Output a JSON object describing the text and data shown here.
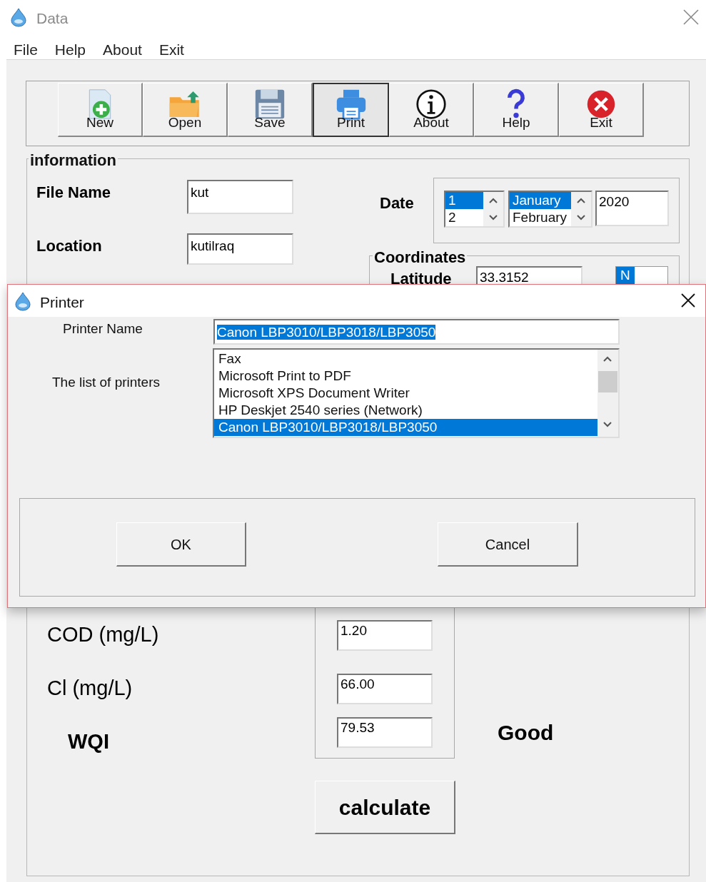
{
  "window": {
    "title": "Data"
  },
  "menu": [
    "File",
    "Help",
    "About",
    "Exit"
  ],
  "toolbar": [
    {
      "label": "New",
      "kind": "new",
      "selected": false
    },
    {
      "label": "Open",
      "kind": "open",
      "selected": false
    },
    {
      "label": "Save",
      "kind": "save",
      "selected": false
    },
    {
      "label": "Print",
      "kind": "print",
      "selected": true
    },
    {
      "label": "About",
      "kind": "info",
      "selected": false
    },
    {
      "label": "Help",
      "kind": "help",
      "selected": false
    },
    {
      "label": "Exit",
      "kind": "exit",
      "selected": false
    }
  ],
  "information": {
    "title": "information",
    "file_name": {
      "label": "File Name",
      "value": "kut"
    },
    "location": {
      "label": "Location",
      "value": "kutilraq"
    },
    "date": {
      "label": "Date",
      "days": [
        {
          "label": "1",
          "selected": true
        },
        {
          "label": "2",
          "selected": false
        }
      ],
      "months": [
        {
          "label": "January",
          "selected": true
        },
        {
          "label": "February",
          "selected": false
        }
      ],
      "year": "2020"
    },
    "coordinates": {
      "title": "Coordinates",
      "latitude": {
        "label": "Latitude",
        "value": "33.3152",
        "hemisphere": "N"
      }
    }
  },
  "results": [
    {
      "label": "COD (mg/L)",
      "value": "1.20"
    },
    {
      "label": "Cl (mg/L)",
      "value": "66.00"
    },
    {
      "label": "WQI",
      "value": "79.53"
    }
  ],
  "quality": "Good",
  "calculate_button": "calculate",
  "dialog": {
    "title": "Printer",
    "printer_name_label": "Printer Name",
    "printer_name": "Canon LBP3010/LBP3018/LBP3050",
    "list_label": "The list of printers",
    "printers": [
      {
        "name": "Fax",
        "selected": false
      },
      {
        "name": "Microsoft Print to PDF",
        "selected": false
      },
      {
        "name": "Microsoft XPS Document Writer",
        "selected": false
      },
      {
        "name": "HP Deskjet 2540 series (Network)",
        "selected": false
      },
      {
        "name": "Canon LBP3010/LBP3018/LBP3050",
        "selected": true
      }
    ],
    "buttons": [
      "OK",
      "Cancel"
    ]
  }
}
